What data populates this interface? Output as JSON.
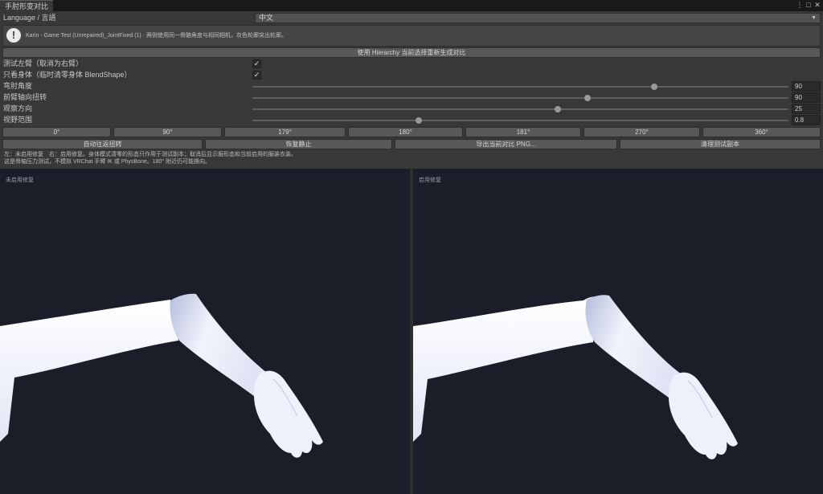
{
  "window": {
    "tab_title": "手肘形变对比",
    "menu_icon": "kebab-menu-icon",
    "maximize_icon": "maximize-icon",
    "close_icon": "close-icon"
  },
  "language": {
    "label": "Language / 言語",
    "value": "中文"
  },
  "help": {
    "icon": "exclamation-icon",
    "text": "Karin - Game Test (Unrepaired)_JointFixed (1) · 两侧使用同一骨骼角度与相同相机，灰色轮廓突出轮廓。"
  },
  "regenerate_button": "使用 Hierarchy 当前选择重新生成对比",
  "toggles": [
    {
      "label": "测试左臂（取消为右臂）",
      "checked": true
    },
    {
      "label": "只看身体（临时清零身体 BlendShape）",
      "checked": true
    }
  ],
  "sliders": [
    {
      "label": "弯肘角度",
      "value": "90",
      "fraction": 0.75
    },
    {
      "label": "前臂轴向扭转",
      "value": "90",
      "fraction": 0.625
    },
    {
      "label": "观察方向",
      "value": "25",
      "fraction": 0.57
    },
    {
      "label": "视野范围",
      "value": "0.8",
      "fraction": 0.31
    }
  ],
  "presets": [
    "0°",
    "90°",
    "179°",
    "180°",
    "181°",
    "270°",
    "360°"
  ],
  "actions": [
    "自动往返扭转",
    "恢复静止",
    "导出当前对比 PNG...",
    "清理测试副本"
  ],
  "info_lines": [
    "左：未启用修复　右：启用修复。身体模式清零的形态只作用于测试副本；取消后显示服形态和当前启用的服装衣装。",
    "这是骨轴压力测试，不模拟 VRChat 手臂 IK 或 PhysBone。180° 附近仍可能换向。"
  ],
  "viewports": [
    {
      "label": "未启用修复"
    },
    {
      "label": "启用修复"
    }
  ]
}
